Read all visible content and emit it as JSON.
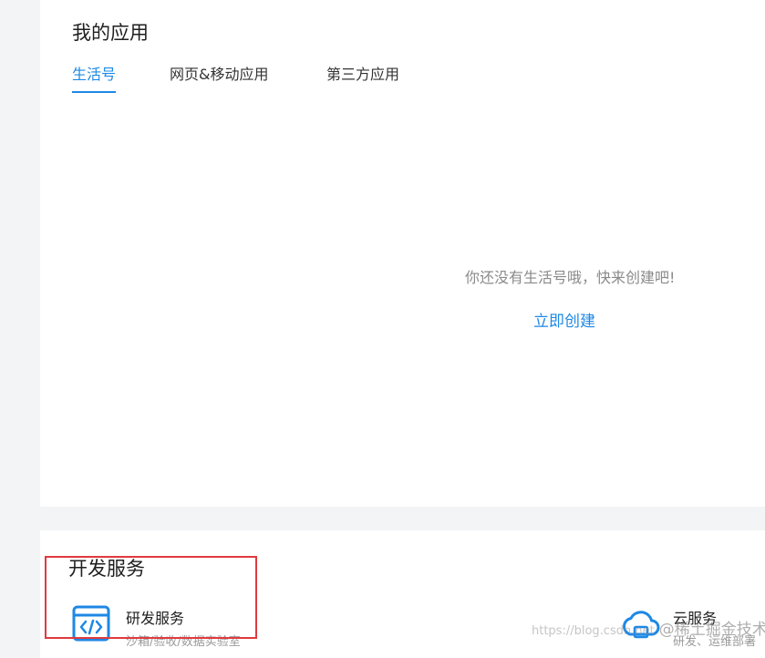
{
  "my_apps": {
    "title": "我的应用",
    "tabs": [
      {
        "label": "生活号",
        "active": true
      },
      {
        "label": "网页&移动应用",
        "active": false
      },
      {
        "label": "第三方应用",
        "active": false
      }
    ],
    "empty_message": "你还没有生活号哦，快来创建吧!",
    "create_link": "立即创建"
  },
  "dev_services": {
    "title": "开发服务",
    "items": [
      {
        "icon": "code-window-icon",
        "name": "研发服务",
        "desc": "沙箱/验收/数据实验室"
      },
      {
        "icon": "cloud-icon",
        "name": "云服务",
        "desc": "研发、运维部署"
      }
    ]
  },
  "watermark": {
    "url": "https://blog.csdn.net",
    "brand": "@稀土掘金技术社区"
  },
  "colors": {
    "accent": "#1e88e5",
    "highlight": "#e03a3e"
  }
}
